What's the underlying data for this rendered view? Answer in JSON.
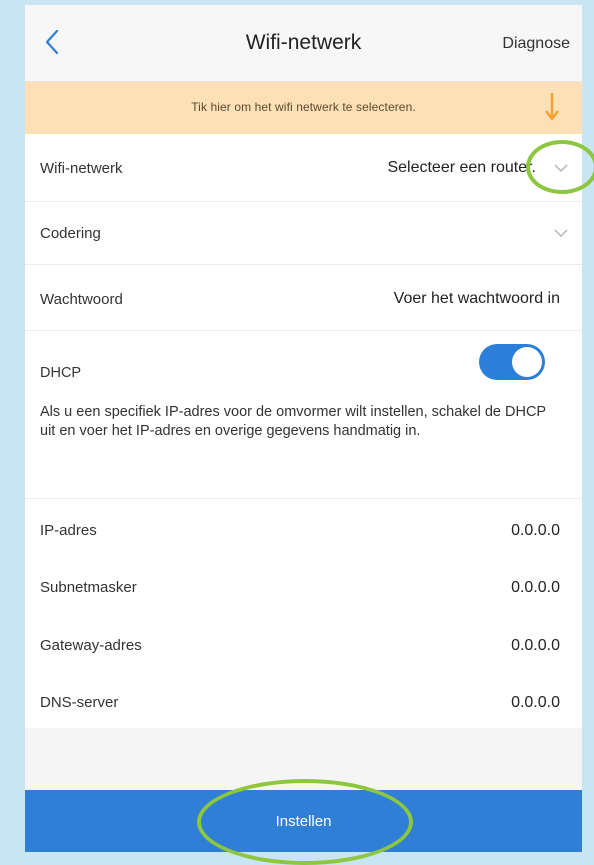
{
  "header": {
    "title": "Wifi-netwerk",
    "back_icon": "chevron-left-icon",
    "diagnose_label": "Diagnose"
  },
  "banner": {
    "text": "Tik hier om het wifi netwerk te selecteren.",
    "icon": "arrow-down-icon",
    "color": "#fde0b6"
  },
  "form": {
    "wifi": {
      "label": "Wifi-netwerk",
      "value": "Selecteer een router."
    },
    "coding": {
      "label": "Codering",
      "value": ""
    },
    "password": {
      "label": "Wachtwoord",
      "placeholder": "Voer het wachtwoord in"
    },
    "dhcp": {
      "label": "DHCP",
      "enabled": true
    },
    "dhcp_help": "Als u een specifiek IP-adres voor de omvormer wilt instellen, schakel de DHCP uit en voer het IP-adres en overige gegevens handmatig in.",
    "ip": {
      "label": "IP-adres",
      "value": "0.0.0.0"
    },
    "subnet": {
      "label": "Subnetmasker",
      "value": "0.0.0.0"
    },
    "gateway": {
      "label": "Gateway-adres",
      "value": "0.0.0.0"
    },
    "dns": {
      "label": "DNS-server",
      "value": "0.0.0.0"
    }
  },
  "submit_label": "Instellen",
  "colors": {
    "accent": "#2f7fd6",
    "highlight_ring": "#8dc63f",
    "arrow": "#f5a033"
  }
}
